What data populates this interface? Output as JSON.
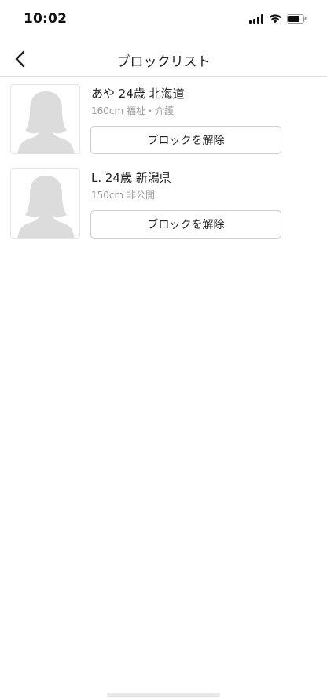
{
  "status_bar": {
    "time": "10:02",
    "icons": [
      "signal-icon",
      "wifi-icon",
      "battery-icon"
    ]
  },
  "nav": {
    "back_icon": "chevron-left-icon",
    "title": "ブロックリスト"
  },
  "blocked_users": [
    {
      "name_line": "あや 24歳 北海道",
      "meta_line": "160cm 福祉・介護",
      "button_label": "ブロックを解除",
      "avatar_icon": "default-female-avatar-icon"
    },
    {
      "name_line": "L. 24歳 新潟県",
      "meta_line": "150cm 非公開",
      "button_label": "ブロックを解除",
      "avatar_icon": "default-female-avatar-icon"
    }
  ],
  "colors": {
    "text": "#222222",
    "meta_text": "#9a9a9a",
    "divider": "#e2e2e2",
    "button_border": "#cfcfcf",
    "avatar_silhouette": "#dcdcdc"
  }
}
